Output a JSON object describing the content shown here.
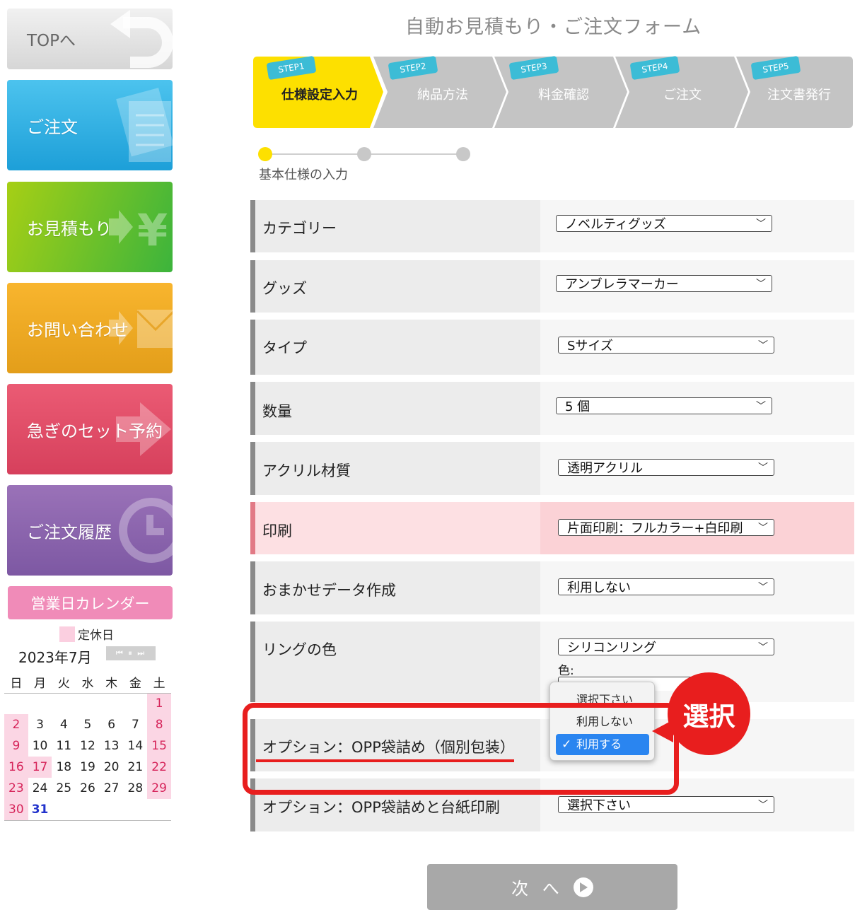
{
  "sidebar": {
    "top_label": "TOPへ",
    "order_label": "ご注文",
    "estimate_label": "お見積もり",
    "contact_label": "お問い合わせ",
    "urgent_label": "急ぎのセット予約",
    "history_label": "ご注文履歴"
  },
  "calendar": {
    "title": "営業日カレンダー",
    "legend": "定休日",
    "month": "2023年7月",
    "nav": "⏮ ⏸ ⏭",
    "weekdays": [
      "日",
      "月",
      "火",
      "水",
      "木",
      "金",
      "土"
    ],
    "weeks": [
      [
        "",
        "",
        "",
        "",
        "",
        "",
        "1"
      ],
      [
        "2",
        "3",
        "4",
        "5",
        "6",
        "7",
        "8"
      ],
      [
        "9",
        "10",
        "11",
        "12",
        "13",
        "14",
        "15"
      ],
      [
        "16",
        "17",
        "18",
        "19",
        "20",
        "21",
        "22"
      ],
      [
        "23",
        "24",
        "25",
        "26",
        "27",
        "28",
        "29"
      ],
      [
        "30",
        "31",
        "",
        "",
        "",
        "",
        ""
      ]
    ],
    "holidays": [
      "1",
      "2",
      "8",
      "9",
      "15",
      "16",
      "17",
      "22",
      "23",
      "29",
      "30"
    ],
    "today": "31"
  },
  "header": {
    "title": "自動お見積もり・ご注文フォーム"
  },
  "steps": [
    {
      "badge": "STEP1",
      "label": "仕様設定入力"
    },
    {
      "badge": "STEP2",
      "label": "納品方法"
    },
    {
      "badge": "STEP3",
      "label": "料金確認"
    },
    {
      "badge": "STEP4",
      "label": "ご注文"
    },
    {
      "badge": "STEP5",
      "label": "注文書発行"
    }
  ],
  "progress": {
    "label": "基本仕様の入力"
  },
  "form": {
    "category": {
      "label": "カテゴリー",
      "value": "ノベルティグッズ"
    },
    "goods": {
      "label": "グッズ",
      "value": "アンブレラマーカー"
    },
    "type": {
      "label": "タイプ",
      "value": "Sサイズ"
    },
    "quantity": {
      "label": "数量",
      "value": "5 個"
    },
    "material": {
      "label": "アクリル材質",
      "value": "透明アクリル"
    },
    "print": {
      "label": "印刷",
      "value": "片面印刷：フルカラー+白印刷"
    },
    "data_creation": {
      "label": "おまかせデータ作成",
      "value": "利用しない"
    },
    "ring": {
      "label": "リングの色",
      "value": "シリコンリング",
      "color_label": "色:"
    },
    "opp": {
      "label": "オプション：OPP袋詰め（個別包装）"
    },
    "opp_card": {
      "label": "オプション：OPP袋詰めと台紙印刷",
      "value": "選択下さい"
    }
  },
  "dropdown": {
    "options": [
      "選択下さい",
      "利用しない",
      "利用する"
    ],
    "selected": "利用する",
    "check": "✓"
  },
  "callout": {
    "text": "選択"
  },
  "next_button": {
    "label": "次 へ"
  },
  "colors": {
    "accent": "#fde000",
    "callout": "#e81e1e",
    "holiday": "#fbd6e4"
  }
}
